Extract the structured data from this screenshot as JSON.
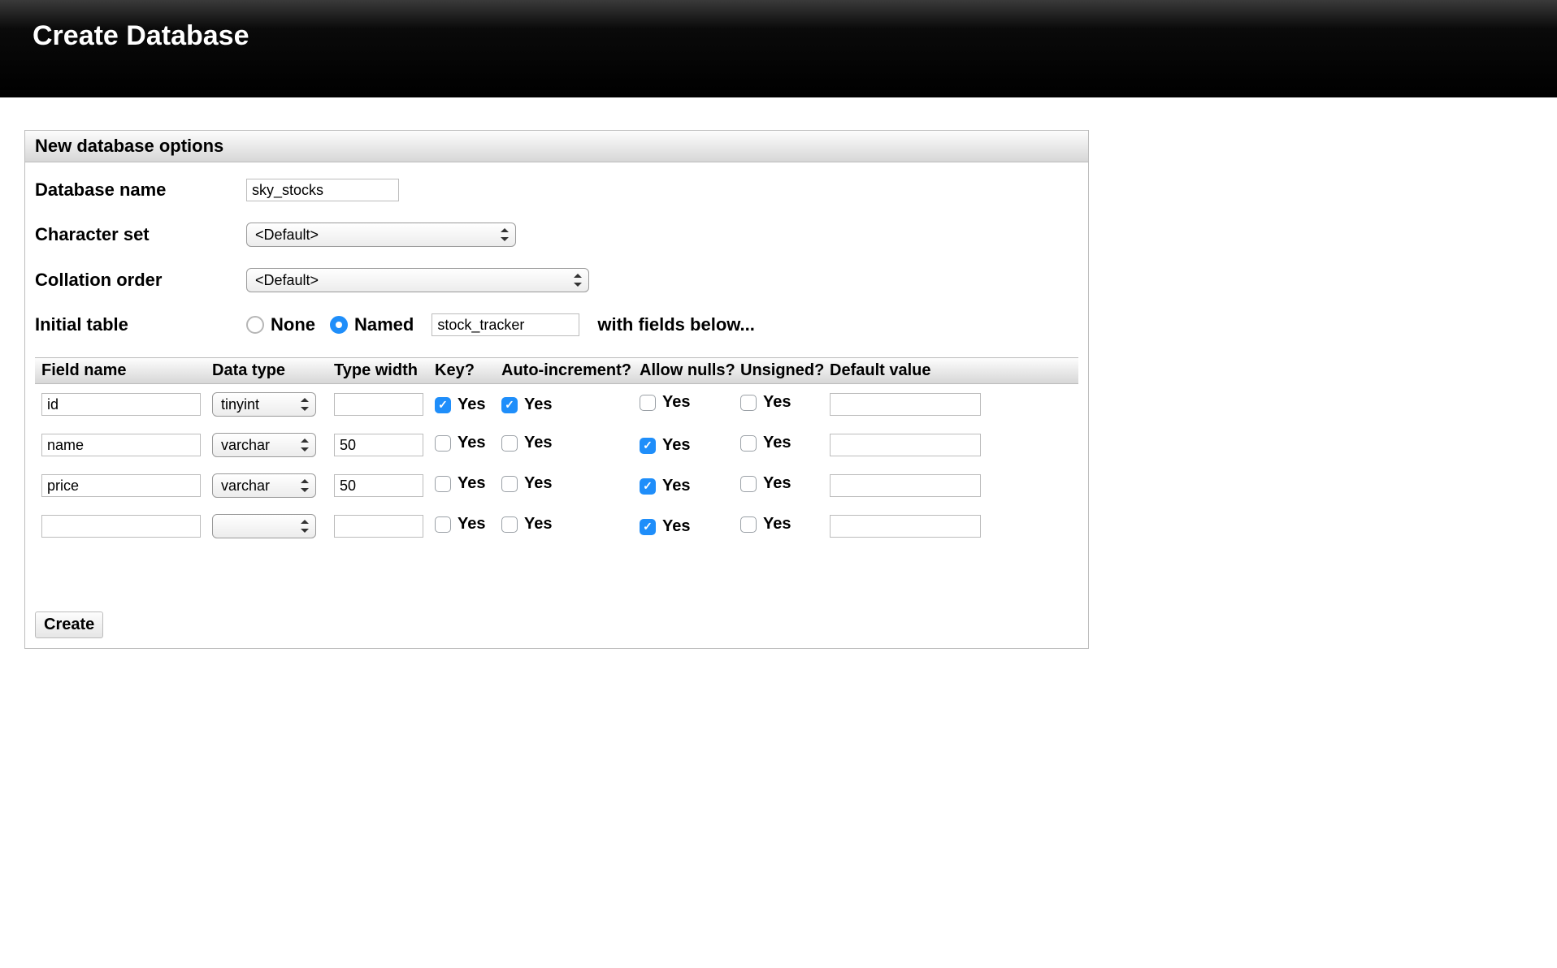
{
  "header": {
    "title": "Create Database"
  },
  "panel": {
    "title": "New database options"
  },
  "labels": {
    "db_name": "Database name",
    "charset": "Character set",
    "collation": "Collation order",
    "initial_table": "Initial table",
    "none": "None",
    "named": "Named",
    "with_fields": "with fields below..."
  },
  "values": {
    "db_name": "sky_stocks",
    "charset": "<Default>",
    "collation": "<Default>",
    "table_name": "stock_tracker",
    "initial_table_mode": "named"
  },
  "grid": {
    "columns": {
      "field_name": "Field name",
      "data_type": "Data type",
      "type_width": "Type width",
      "key": "Key?",
      "auto_inc": "Auto-increment?",
      "allow_nulls": "Allow nulls?",
      "unsigned": "Unsigned?",
      "default_value": "Default value"
    },
    "check_label": "Yes",
    "rows": [
      {
        "field_name": "id",
        "data_type": "tinyint",
        "type_width": "",
        "key": true,
        "auto_inc": true,
        "allow_nulls": false,
        "unsigned": false,
        "default_value": ""
      },
      {
        "field_name": "name",
        "data_type": "varchar",
        "type_width": "50",
        "key": false,
        "auto_inc": false,
        "allow_nulls": true,
        "unsigned": false,
        "default_value": ""
      },
      {
        "field_name": "price",
        "data_type": "varchar",
        "type_width": "50",
        "key": false,
        "auto_inc": false,
        "allow_nulls": true,
        "unsigned": false,
        "default_value": ""
      },
      {
        "field_name": "",
        "data_type": "",
        "type_width": "",
        "key": false,
        "auto_inc": false,
        "allow_nulls": true,
        "unsigned": false,
        "default_value": ""
      }
    ]
  },
  "buttons": {
    "create": "Create"
  }
}
